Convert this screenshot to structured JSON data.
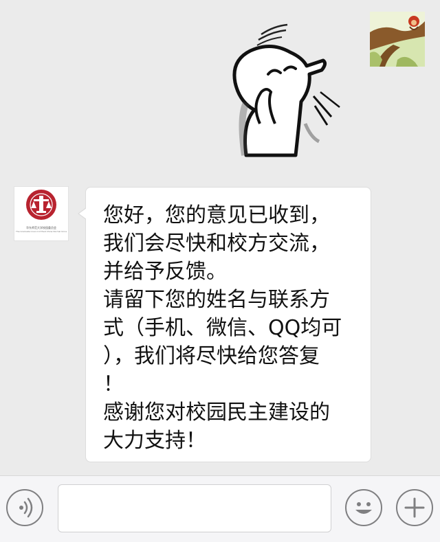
{
  "chat": {
    "messages": [
      {
        "sender": "self",
        "type": "sticker",
        "sticker_icon": "waving-cartoon-character-sticker"
      },
      {
        "sender": "other",
        "type": "text",
        "lines": [
          "您好，您的意见已收到，",
          "我们会尽快和校方交流，",
          "并给予反馈。",
          "请留下您的姓名与联系方",
          "式（手机、微信、QQ均可",
          "），我们将尽快给您答复",
          "！",
          "感谢您对校园民主建设的",
          "大力支持！"
        ]
      }
    ]
  },
  "avatars": {
    "self_icon": "tree-branch-monkey-avatar",
    "other_icon": "student-council-logo-avatar",
    "other_caption": "华东师范大学校园委员会",
    "other_caption_en": "The Graduate Council of East China Normal University"
  },
  "input_bar": {
    "voice_icon": "voice-icon",
    "emoji_icon": "emoji-icon",
    "plus_icon": "plus-icon",
    "text_value": ""
  },
  "colors": {
    "chat_background": "#ebebeb",
    "bubble_background": "#ffffff",
    "logo_red": "#b8232f",
    "icon_gray": "#7f7f81"
  }
}
